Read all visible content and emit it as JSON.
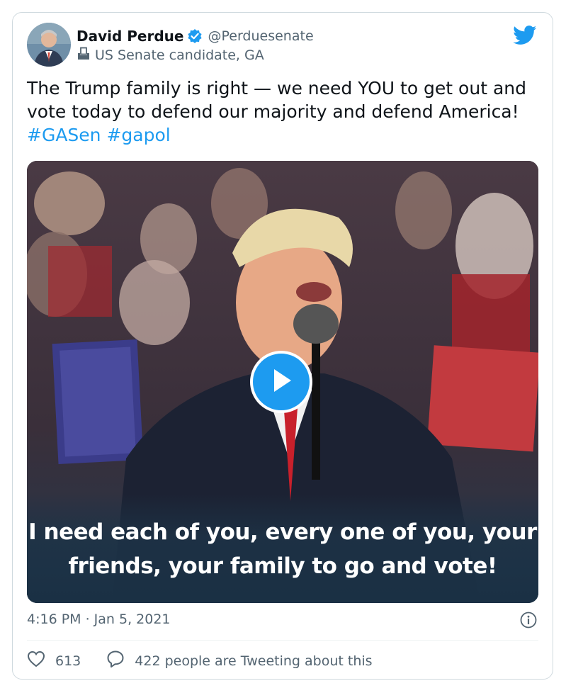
{
  "author": {
    "name": "David Perdue",
    "handle": "@Perduesenate",
    "label": "US Senate candidate, GA",
    "verified": true
  },
  "tweet": {
    "text_plain": "The Trump family is right — we need YOU to get out and vote today to defend our majority and defend America! ",
    "hashtags": [
      "#GASen",
      "#gapol"
    ]
  },
  "media": {
    "caption_line1": "I need each of you, every one of you, your",
    "caption_line2": "friends, your family to go and vote!",
    "type": "video"
  },
  "meta": {
    "timestamp": "4:16 PM · Jan 5, 2021"
  },
  "actions": {
    "likes": "613",
    "tweeting": "422 people are Tweeting about this"
  },
  "colors": {
    "accent": "#1d9bf0",
    "text": "#0f1419",
    "secondary": "#536471",
    "border": "#cfd9de"
  },
  "icons": [
    "verified-badge-icon",
    "twitter-bird-icon",
    "ballot-box-icon",
    "play-icon",
    "info-icon",
    "heart-icon",
    "speech-bubble-icon"
  ]
}
